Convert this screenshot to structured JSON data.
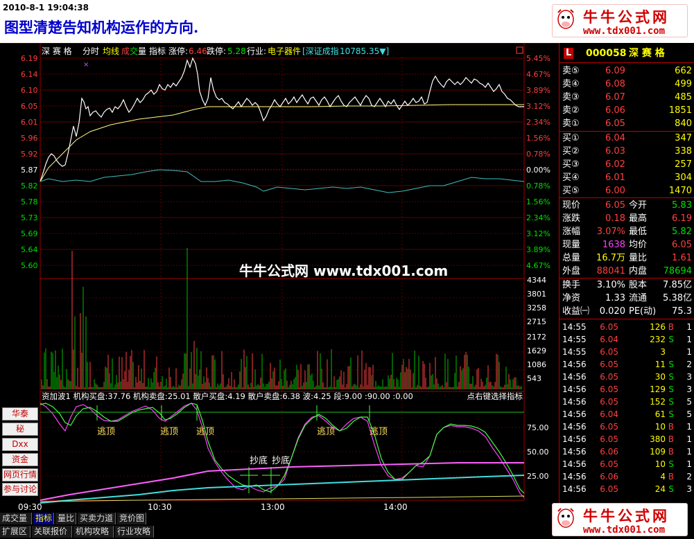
{
  "header": {
    "timestamp": "2010-8-1 19:04:38",
    "caption": "图型清楚告知机构运作的方向.",
    "logo_name": "牛牛公式网",
    "logo_url": "www.tdx001.com"
  },
  "watermark": "牛牛公式网 www.tdx001.com",
  "chart_bar": {
    "name": "深 赛 格",
    "t1": "分时",
    "t2": "均线",
    "t3a": "成",
    "t3b": "交",
    "t3c": "量",
    "t4": "指标",
    "up_label": "涨停:",
    "up_val": "6.46",
    "dn_label": "跌停:",
    "dn_val": "5.28",
    "ind_label": "行业:",
    "ind_val": "电子器件",
    "idx_label": "[深证成指",
    "idx_val": "10785.35▼]"
  },
  "price_axis": [
    "6.19",
    "6.14",
    "6.10",
    "6.05",
    "6.01",
    "5.96",
    "5.92",
    "5.87",
    "5.82",
    "5.78",
    "5.73",
    "5.69",
    "5.64",
    "5.60"
  ],
  "pct_axis": [
    "5.45%",
    "4.67%",
    "3.89%",
    "3.12%",
    "2.34%",
    "1.56%",
    "0.78%",
    "0.00%",
    "0.78%",
    "1.56%",
    "2.34%",
    "3.12%",
    "3.89%",
    "4.67%"
  ],
  "vol_axis": [
    "4344",
    "3801",
    "3258",
    "2715",
    "2172",
    "1629",
    "1086",
    "543"
  ],
  "ind_axis": [
    "75.00",
    "50.00",
    "25.00"
  ],
  "time_axis": [
    "09:30",
    "10:30",
    "13:00",
    "14:00"
  ],
  "indicator": {
    "header": "资加波1 机构买盘:37.76 机构卖盘:25.01 散户买盘:4.19 散户卖盘:6.38 波:4.25 段:9.00 :90.00 :0.00",
    "hint": "点右键选择指标",
    "labels": [
      "逃顶",
      "逃顶",
      "逃顶",
      "逃顶",
      "逃顶",
      "抄底",
      "抄底"
    ]
  },
  "left_buttons": [
    "华泰",
    "秘",
    "Dxx",
    "资金",
    "网页行情",
    "参与讨论"
  ],
  "quote": {
    "badge": "L",
    "code": "000058",
    "name": "深 赛 格",
    "sells": [
      {
        "label": "卖⑤",
        "price": "6.09",
        "vol": "662"
      },
      {
        "label": "卖④",
        "price": "6.08",
        "vol": "499"
      },
      {
        "label": "卖③",
        "price": "6.07",
        "vol": "485"
      },
      {
        "label": "卖②",
        "price": "6.06",
        "vol": "1851"
      },
      {
        "label": "卖①",
        "price": "6.05",
        "vol": "840"
      }
    ],
    "buys": [
      {
        "label": "买①",
        "price": "6.04",
        "vol": "347"
      },
      {
        "label": "买②",
        "price": "6.03",
        "vol": "338"
      },
      {
        "label": "买③",
        "price": "6.02",
        "vol": "257"
      },
      {
        "label": "买④",
        "price": "6.01",
        "vol": "304"
      },
      {
        "label": "买⑤",
        "price": "6.00",
        "vol": "1470"
      }
    ],
    "stats1": [
      {
        "l1": "现价",
        "v1": "6.05",
        "c1": "#ff4040",
        "l2": "今开",
        "v2": "5.83",
        "c2": "#00e000"
      },
      {
        "l1": "涨跌",
        "v1": "0.18",
        "c1": "#ff4040",
        "l2": "最高",
        "v2": "6.19",
        "c2": "#ff4040"
      },
      {
        "l1": "涨幅",
        "v1": "3.07%",
        "c1": "#ff4040",
        "l2": "最低",
        "v2": "5.82",
        "c2": "#00e000"
      },
      {
        "l1": "现量",
        "v1": "1638",
        "c1": "#ff40ff",
        "l2": "均价",
        "v2": "6.05",
        "c2": "#ff4040"
      },
      {
        "l1": "总量",
        "v1": "16.7万",
        "c1": "#ffff00",
        "l2": "量比",
        "v2": "1.61",
        "c2": "#ff4040"
      },
      {
        "l1": "外盘",
        "v1": "88041",
        "c1": "#ff4040",
        "l2": "内盘",
        "v2": "78694",
        "c2": "#00e000"
      }
    ],
    "stats2": [
      {
        "l1": "换手",
        "v1": "3.10%",
        "l2": "股本",
        "v2": "7.85亿"
      },
      {
        "l1": "净资",
        "v1": "1.33",
        "l2": "流通",
        "v2": "5.38亿"
      },
      {
        "l1": "收益㈠",
        "v1": "0.020",
        "l2": "PE(动)",
        "v2": "75.3"
      }
    ],
    "ticks": [
      {
        "t": "14:55",
        "p": "6.05",
        "v": "126",
        "s": "B"
      },
      {
        "t": "14:55",
        "p": "6.04",
        "v": "232",
        "s": "S"
      },
      {
        "t": "14:55",
        "p": "6.05",
        "v": "3",
        "s": ""
      },
      {
        "t": "14:56",
        "p": "6.05",
        "v": "11",
        "s": "S"
      },
      {
        "t": "14:56",
        "p": "6.05",
        "v": "30",
        "s": "S"
      },
      {
        "t": "14:56",
        "p": "6.05",
        "v": "129",
        "s": "S"
      },
      {
        "t": "14:56",
        "p": "6.05",
        "v": "152",
        "s": "S"
      },
      {
        "t": "14:56",
        "p": "6.04",
        "v": "61",
        "s": "S"
      },
      {
        "t": "14:56",
        "p": "6.05",
        "v": "10",
        "s": "B"
      },
      {
        "t": "14:56",
        "p": "6.05",
        "v": "380",
        "s": "B"
      },
      {
        "t": "14:56",
        "p": "6.06",
        "v": "109",
        "s": "B"
      },
      {
        "t": "14:56",
        "p": "6.05",
        "v": "10",
        "s": "S"
      },
      {
        "t": "14:56",
        "p": "6.06",
        "v": "4",
        "s": "B"
      },
      {
        "t": "14:56",
        "p": "6.05",
        "v": "24",
        "s": "S"
      }
    ],
    "tick_extra": [
      "1",
      "1",
      "1",
      "2",
      "3",
      "3",
      "5",
      "5",
      "1",
      "1",
      "1",
      "1",
      "2",
      "3"
    ]
  },
  "bottom_tabs1": [
    "成交量",
    "指标",
    "量比",
    "买卖力道",
    "竞价图"
  ],
  "bottom_tabs2": [
    "扩展区",
    "关联报价",
    "机构攻略",
    "行业攻略"
  ],
  "colors": {
    "up": "#ff4040",
    "down": "#00e000",
    "grid": "#a00000",
    "price_line": "#ffffff",
    "avg_line": "#ffff80"
  }
}
